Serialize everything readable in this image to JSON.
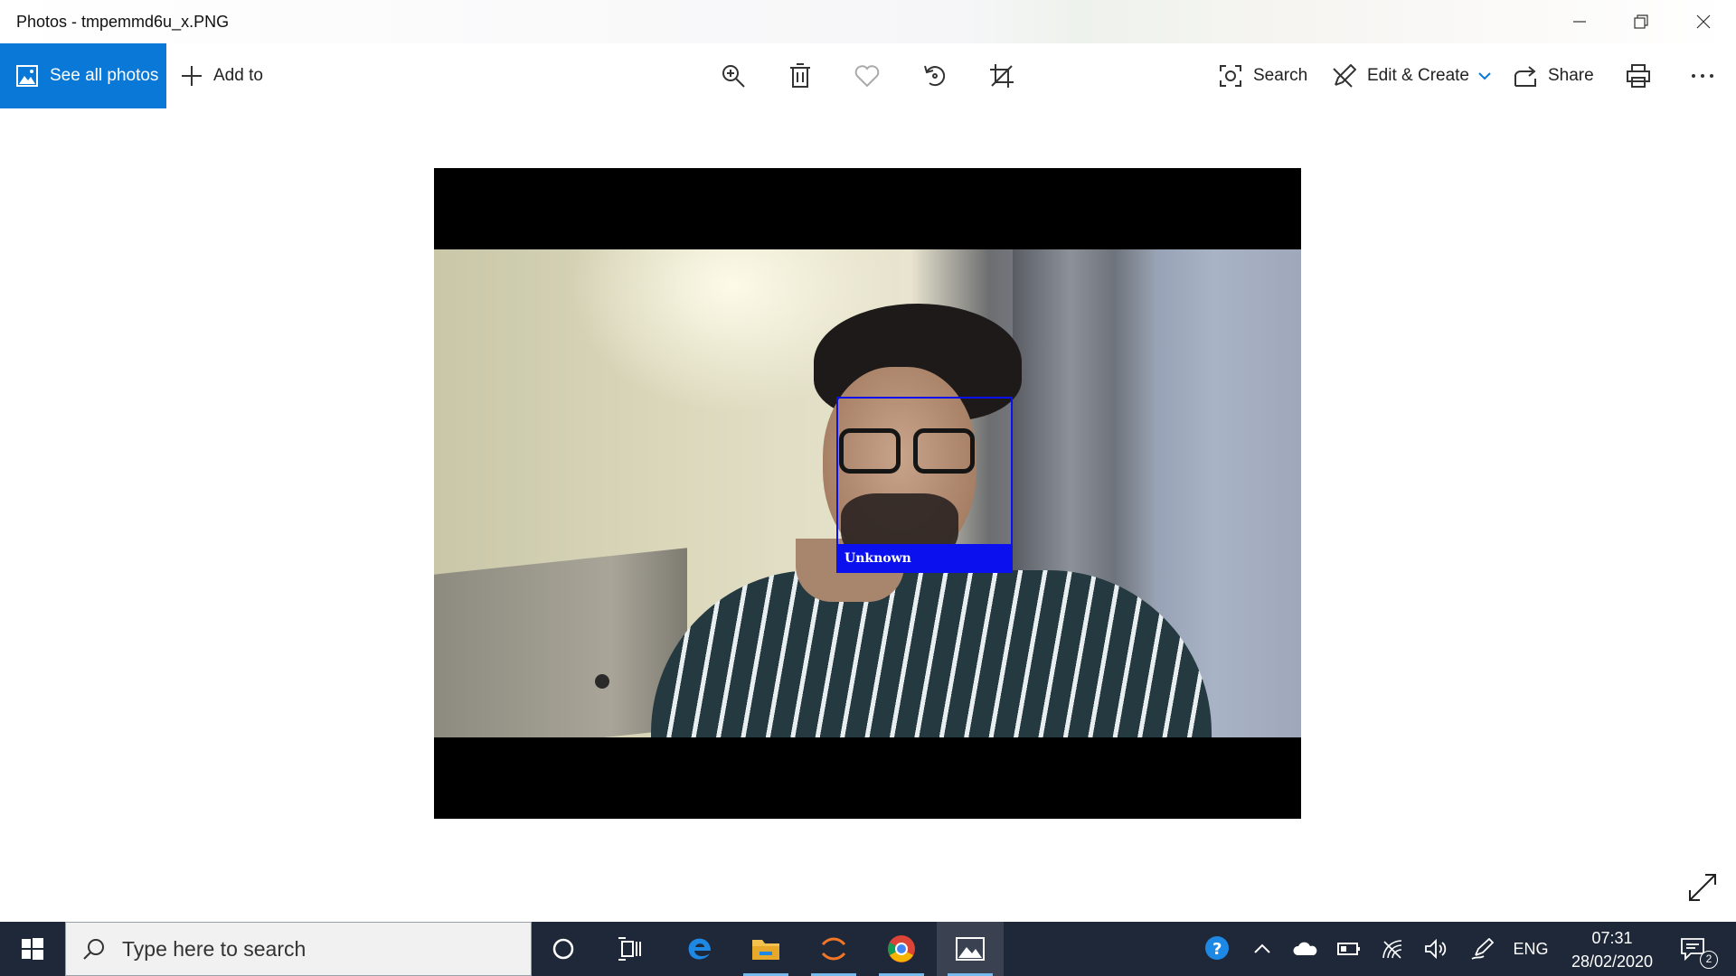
{
  "window": {
    "title": "Photos - tmpemmd6u_x.PNG"
  },
  "toolbar": {
    "see_all_label": "See all photos",
    "add_to_label": "Add to",
    "search_label": "Search",
    "edit_create_label": "Edit & Create",
    "share_label": "Share"
  },
  "photo": {
    "detection_label": "Unknown"
  },
  "taskbar": {
    "search_placeholder": "Type here to search",
    "language": "ENG",
    "time": "07:31",
    "date": "28/02/2020",
    "notification_count": "2"
  },
  "colors": {
    "accent": "#0a78d7",
    "taskbar_bg": "#1f2838",
    "detection_box": "#0a10ee"
  }
}
